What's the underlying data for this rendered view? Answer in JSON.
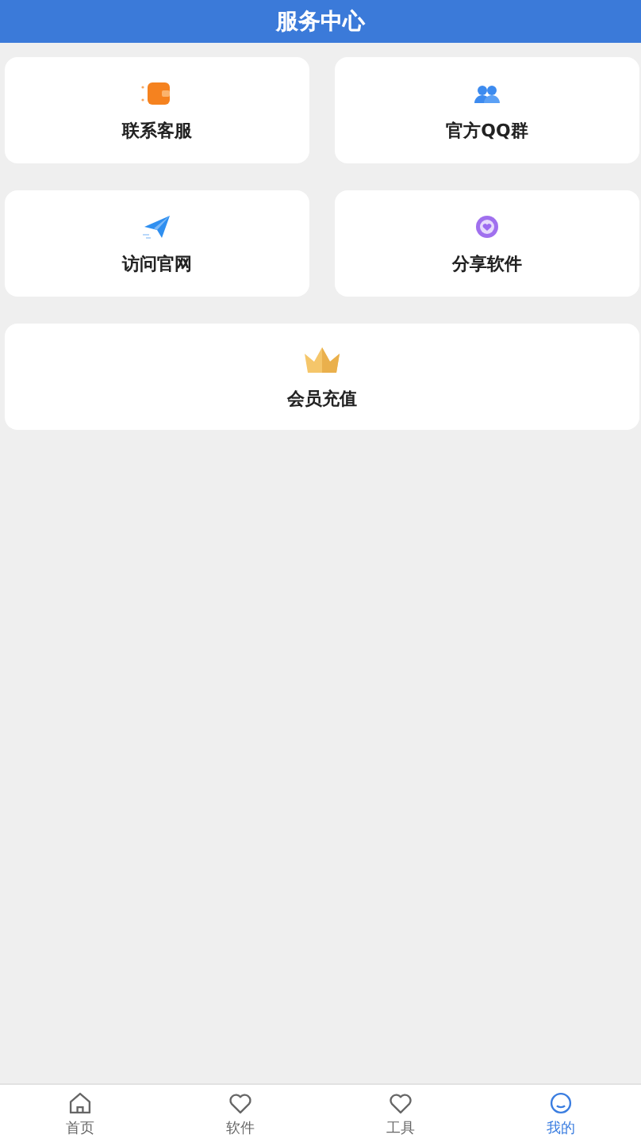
{
  "header": {
    "title": "服务中心"
  },
  "cards": [
    {
      "label": "联系客服",
      "kind": "half"
    },
    {
      "label": "官方QQ群",
      "kind": "half"
    },
    {
      "label": "访问官网",
      "kind": "half"
    },
    {
      "label": "分享软件",
      "kind": "half"
    },
    {
      "label": "会员充值",
      "kind": "wide"
    }
  ],
  "tab_bar": [
    {
      "label": "首页",
      "selected": false
    },
    {
      "label": "软件",
      "selected": false
    },
    {
      "label": "工具",
      "selected": false
    },
    {
      "label": "我的",
      "selected": true
    }
  ]
}
